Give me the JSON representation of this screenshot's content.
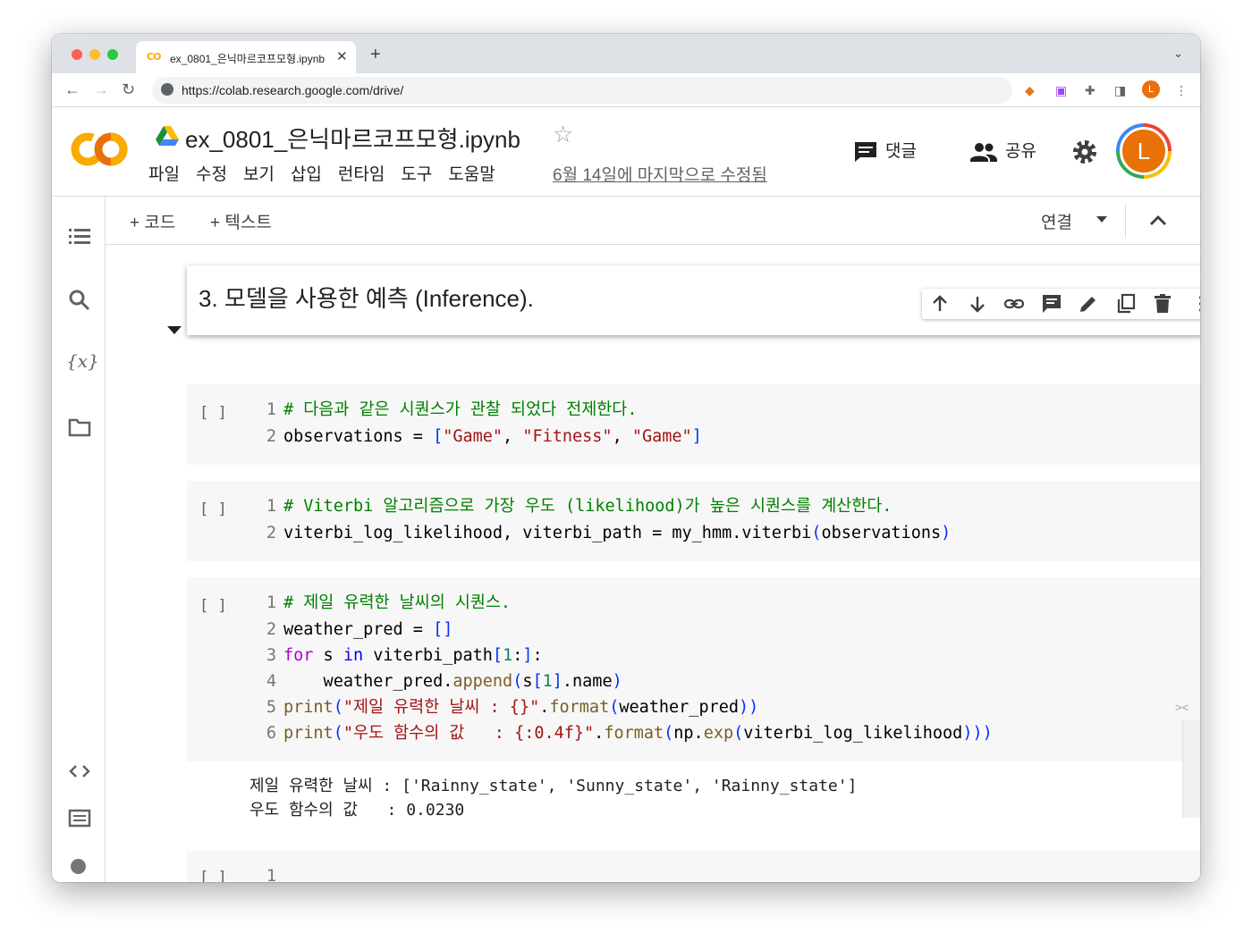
{
  "browser": {
    "tab_title": "ex_0801_은닉마르코프모형.ipynb",
    "tab_favicon": "CO",
    "url": "https://colab.research.google.com/drive/",
    "profile_initial": "L"
  },
  "header": {
    "notebook_title": "ex_0801_은닉마르코프모형.ipynb",
    "menu": [
      "파일",
      "수정",
      "보기",
      "삽입",
      "런타임",
      "도구",
      "도움말"
    ],
    "last_edited": "6월 14일에 마지막으로 수정됨",
    "comments_label": "댓글",
    "share_label": "공유",
    "avatar_initial": "L"
  },
  "toolbar": {
    "add_code": "+ 코드",
    "add_text": "+ 텍스트",
    "connect": "연결"
  },
  "text_cell": {
    "heading": "3. 모델을 사용한 예측 (Inference)."
  },
  "code_cells": [
    {
      "prompt": "[ ]",
      "lines": [
        "# 다음과 같은 시퀀스가 관찰 되었다 전제한다.",
        "observations = [\"Game\", \"Fitness\", \"Game\"]"
      ]
    },
    {
      "prompt": "[ ]",
      "lines": [
        "# Viterbi 알고리즘으로 가장 우도 (likelihood)가 높은 시퀀스를 계산한다.",
        "viterbi_log_likelihood, viterbi_path = my_hmm.viterbi(observations)"
      ]
    },
    {
      "prompt": "[ ]",
      "lines": [
        "# 제일 유력한 날씨의 시퀀스.",
        "weather_pred = []",
        "for s in viterbi_path[1:]:",
        "    weather_pred.append(s[1].name)",
        "print(\"제일 유력한 날씨 : {}\".format(weather_pred))",
        "print(\"우도 함수의 값   : {:0.4f}\".format(np.exp(viterbi_log_likelihood)))"
      ],
      "output": [
        "제일 유력한 날씨 : ['Rainny_state', 'Sunny_state', 'Rainny_state']",
        "우도 함수의 값   : 0.0230"
      ]
    },
    {
      "prompt": "[ ]",
      "lines": [
        ""
      ]
    }
  ],
  "line_numbers": [
    "1",
    "2",
    "3",
    "4",
    "5",
    "6"
  ]
}
